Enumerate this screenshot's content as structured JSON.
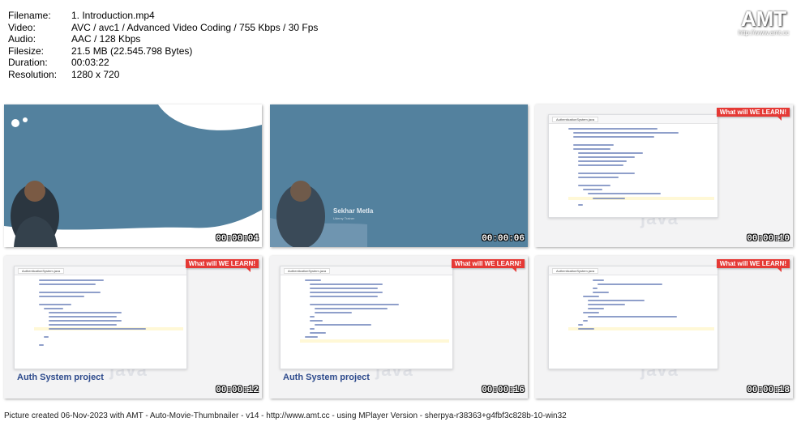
{
  "meta": [
    {
      "key": "Filename:",
      "value": "1. Introduction.mp4"
    },
    {
      "key": "Video:",
      "value": "AVC / avc1 / Advanced Video Coding / 755 Kbps / 30 Fps"
    },
    {
      "key": "Audio:",
      "value": "AAC / 128 Kbps"
    },
    {
      "key": "Filesize:",
      "value": "21.5 MB (22.545.798 Bytes)"
    },
    {
      "key": "Duration:",
      "value": "00:03:22"
    },
    {
      "key": "Resolution:",
      "value": "1280 x 720"
    }
  ],
  "logo": {
    "big": "AMT",
    "small": "http://www.amt.cc"
  },
  "thumbs": [
    {
      "time": "00:00:04"
    },
    {
      "time": "00:00:06",
      "speaker": "Sekhar Metla",
      "speaker_sub": "Udemy Trainer"
    },
    {
      "time": "00:00:10",
      "tab": "AuthenticationSystem.java",
      "badge": "What will WE LEARN!"
    },
    {
      "time": "00:00:12",
      "tab": "AuthenticationSystem.java",
      "badge": "What will WE LEARN!",
      "caption": "Auth System project"
    },
    {
      "time": "00:00:16",
      "tab": "AuthenticationSystem.java",
      "badge": "What will WE LEARN!",
      "caption": "Auth System project"
    },
    {
      "time": "00:00:18",
      "tab": "AuthenticationSystem.java",
      "badge": "What will WE LEARN!"
    }
  ],
  "watermark": "java",
  "footer": "Picture created 06-Nov-2023 with AMT - Auto-Movie-Thumbnailer - v14 - http://www.amt.cc - using MPlayer Version - sherpya-r38363+g4fbf3c828b-10-win32"
}
